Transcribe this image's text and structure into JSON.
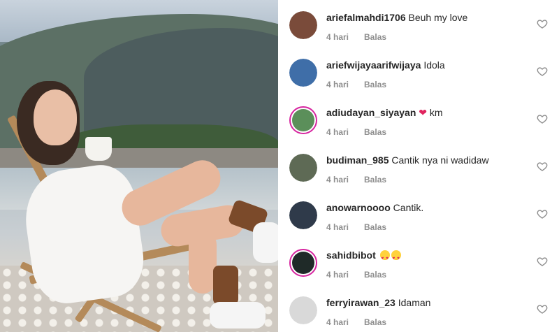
{
  "comments": [
    {
      "username": "ariefalmahdi1706",
      "text": "Beuh my love",
      "time": "4 hari",
      "reply": "Balas",
      "avatar_color": "#7a4b3a",
      "avatar_ring": false
    },
    {
      "username": "ariefwijayaarifwijaya",
      "text": "Idola",
      "time": "4 hari",
      "reply": "Balas",
      "avatar_color": "#3f6ea8",
      "avatar_ring": false
    },
    {
      "username": "adiudayan_siyayan",
      "text": "km",
      "emoji": "heart",
      "time": "4 hari",
      "reply": "Balas",
      "avatar_color": "#5b8f5a",
      "avatar_ring": true
    },
    {
      "username": "budiman_985",
      "text": "Cantik nya ni wadidaw",
      "time": "4 hari",
      "reply": "Balas",
      "avatar_color": "#5e6a55",
      "avatar_ring": false
    },
    {
      "username": "anowarnoooo",
      "text": "Cantik.",
      "time": "4 hari",
      "reply": "Balas",
      "avatar_color": "#2f3a4a",
      "avatar_ring": false
    },
    {
      "username": "sahidbibot",
      "text": "",
      "emoji": "heart-eyes-x2",
      "time": "4 hari",
      "reply": "Balas",
      "avatar_color": "#1f2a28",
      "avatar_ring": true
    },
    {
      "username": "ferryirawan_23",
      "text": "Idaman",
      "time": "4 hari",
      "reply": "Balas",
      "avatar_color": "#d9d9d9",
      "avatar_ring": false
    }
  ],
  "icons": {
    "like": "heart-outline-icon"
  },
  "colors": {
    "story_ring": "#d6249f",
    "muted_text": "#8e8e8e",
    "primary_text": "#262626"
  }
}
